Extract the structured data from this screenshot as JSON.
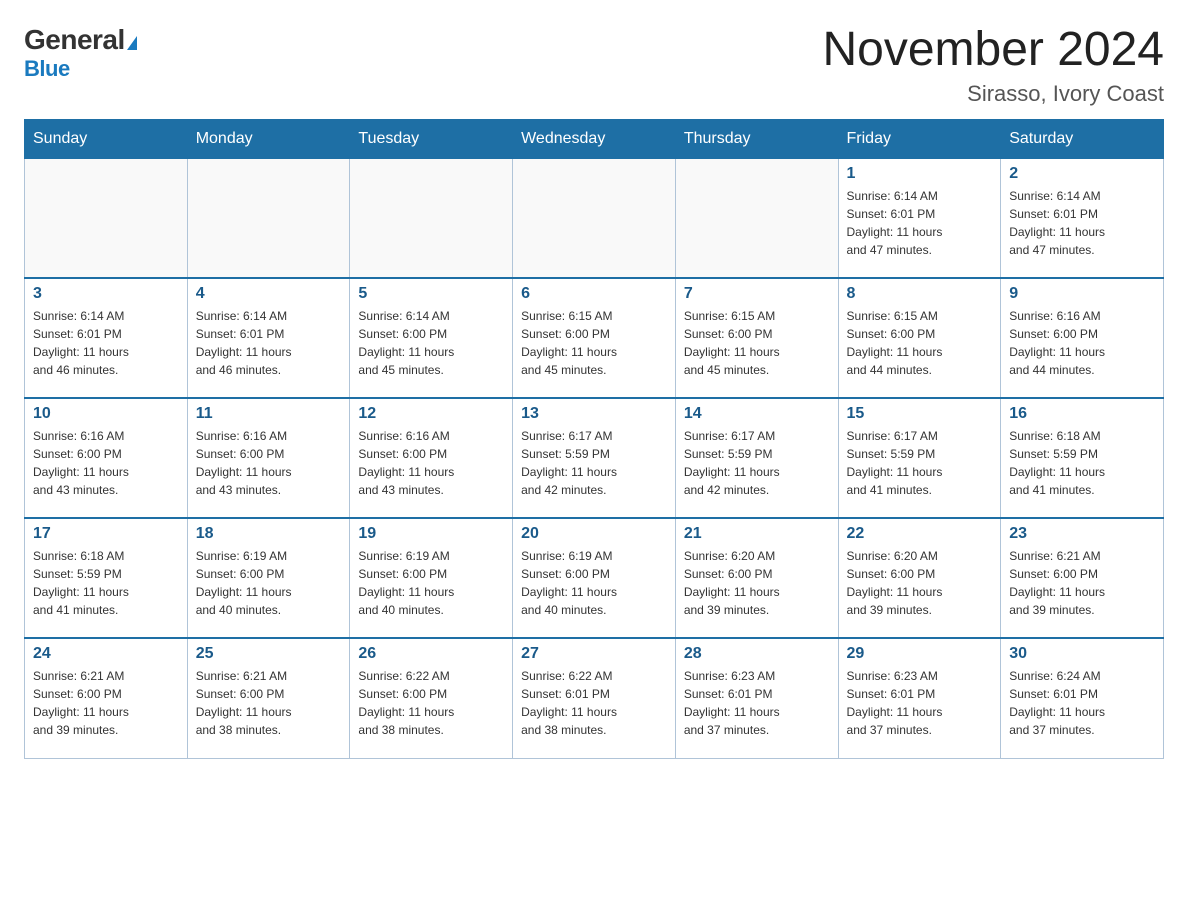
{
  "logo": {
    "general": "General",
    "blue": "Blue",
    "triangle": "▶"
  },
  "header": {
    "month": "November 2024",
    "location": "Sirasso, Ivory Coast"
  },
  "weekdays": [
    "Sunday",
    "Monday",
    "Tuesday",
    "Wednesday",
    "Thursday",
    "Friday",
    "Saturday"
  ],
  "weeks": [
    [
      {
        "day": "",
        "info": ""
      },
      {
        "day": "",
        "info": ""
      },
      {
        "day": "",
        "info": ""
      },
      {
        "day": "",
        "info": ""
      },
      {
        "day": "",
        "info": ""
      },
      {
        "day": "1",
        "info": "Sunrise: 6:14 AM\nSunset: 6:01 PM\nDaylight: 11 hours\nand 47 minutes."
      },
      {
        "day": "2",
        "info": "Sunrise: 6:14 AM\nSunset: 6:01 PM\nDaylight: 11 hours\nand 47 minutes."
      }
    ],
    [
      {
        "day": "3",
        "info": "Sunrise: 6:14 AM\nSunset: 6:01 PM\nDaylight: 11 hours\nand 46 minutes."
      },
      {
        "day": "4",
        "info": "Sunrise: 6:14 AM\nSunset: 6:01 PM\nDaylight: 11 hours\nand 46 minutes."
      },
      {
        "day": "5",
        "info": "Sunrise: 6:14 AM\nSunset: 6:00 PM\nDaylight: 11 hours\nand 45 minutes."
      },
      {
        "day": "6",
        "info": "Sunrise: 6:15 AM\nSunset: 6:00 PM\nDaylight: 11 hours\nand 45 minutes."
      },
      {
        "day": "7",
        "info": "Sunrise: 6:15 AM\nSunset: 6:00 PM\nDaylight: 11 hours\nand 45 minutes."
      },
      {
        "day": "8",
        "info": "Sunrise: 6:15 AM\nSunset: 6:00 PM\nDaylight: 11 hours\nand 44 minutes."
      },
      {
        "day": "9",
        "info": "Sunrise: 6:16 AM\nSunset: 6:00 PM\nDaylight: 11 hours\nand 44 minutes."
      }
    ],
    [
      {
        "day": "10",
        "info": "Sunrise: 6:16 AM\nSunset: 6:00 PM\nDaylight: 11 hours\nand 43 minutes."
      },
      {
        "day": "11",
        "info": "Sunrise: 6:16 AM\nSunset: 6:00 PM\nDaylight: 11 hours\nand 43 minutes."
      },
      {
        "day": "12",
        "info": "Sunrise: 6:16 AM\nSunset: 6:00 PM\nDaylight: 11 hours\nand 43 minutes."
      },
      {
        "day": "13",
        "info": "Sunrise: 6:17 AM\nSunset: 5:59 PM\nDaylight: 11 hours\nand 42 minutes."
      },
      {
        "day": "14",
        "info": "Sunrise: 6:17 AM\nSunset: 5:59 PM\nDaylight: 11 hours\nand 42 minutes."
      },
      {
        "day": "15",
        "info": "Sunrise: 6:17 AM\nSunset: 5:59 PM\nDaylight: 11 hours\nand 41 minutes."
      },
      {
        "day": "16",
        "info": "Sunrise: 6:18 AM\nSunset: 5:59 PM\nDaylight: 11 hours\nand 41 minutes."
      }
    ],
    [
      {
        "day": "17",
        "info": "Sunrise: 6:18 AM\nSunset: 5:59 PM\nDaylight: 11 hours\nand 41 minutes."
      },
      {
        "day": "18",
        "info": "Sunrise: 6:19 AM\nSunset: 6:00 PM\nDaylight: 11 hours\nand 40 minutes."
      },
      {
        "day": "19",
        "info": "Sunrise: 6:19 AM\nSunset: 6:00 PM\nDaylight: 11 hours\nand 40 minutes."
      },
      {
        "day": "20",
        "info": "Sunrise: 6:19 AM\nSunset: 6:00 PM\nDaylight: 11 hours\nand 40 minutes."
      },
      {
        "day": "21",
        "info": "Sunrise: 6:20 AM\nSunset: 6:00 PM\nDaylight: 11 hours\nand 39 minutes."
      },
      {
        "day": "22",
        "info": "Sunrise: 6:20 AM\nSunset: 6:00 PM\nDaylight: 11 hours\nand 39 minutes."
      },
      {
        "day": "23",
        "info": "Sunrise: 6:21 AM\nSunset: 6:00 PM\nDaylight: 11 hours\nand 39 minutes."
      }
    ],
    [
      {
        "day": "24",
        "info": "Sunrise: 6:21 AM\nSunset: 6:00 PM\nDaylight: 11 hours\nand 39 minutes."
      },
      {
        "day": "25",
        "info": "Sunrise: 6:21 AM\nSunset: 6:00 PM\nDaylight: 11 hours\nand 38 minutes."
      },
      {
        "day": "26",
        "info": "Sunrise: 6:22 AM\nSunset: 6:00 PM\nDaylight: 11 hours\nand 38 minutes."
      },
      {
        "day": "27",
        "info": "Sunrise: 6:22 AM\nSunset: 6:01 PM\nDaylight: 11 hours\nand 38 minutes."
      },
      {
        "day": "28",
        "info": "Sunrise: 6:23 AM\nSunset: 6:01 PM\nDaylight: 11 hours\nand 37 minutes."
      },
      {
        "day": "29",
        "info": "Sunrise: 6:23 AM\nSunset: 6:01 PM\nDaylight: 11 hours\nand 37 minutes."
      },
      {
        "day": "30",
        "info": "Sunrise: 6:24 AM\nSunset: 6:01 PM\nDaylight: 11 hours\nand 37 minutes."
      }
    ]
  ]
}
